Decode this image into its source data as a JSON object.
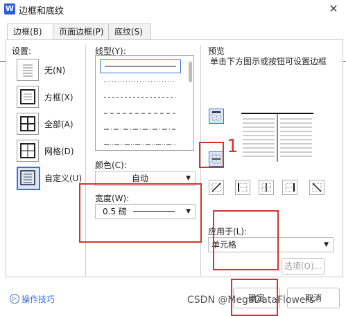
{
  "window": {
    "app_icon_letter": "W",
    "title": "边框和底纹",
    "close_glyph": "✕"
  },
  "tabs": [
    {
      "label": "边框(B)",
      "active": true
    },
    {
      "label": "页面边框(P)",
      "active": false
    },
    {
      "label": "底纹(S)",
      "active": false
    }
  ],
  "settings": {
    "label": "设置:",
    "items": [
      {
        "label": "无(N)",
        "icon": "none-border-icon"
      },
      {
        "label": "方框(X)",
        "icon": "box-border-icon"
      },
      {
        "label": "全部(A)",
        "icon": "all-border-icon"
      },
      {
        "label": "网格(D)",
        "icon": "grid-border-icon"
      },
      {
        "label": "自定义(U)",
        "icon": "custom-border-icon",
        "selected": true
      }
    ]
  },
  "line_style": {
    "label": "线型(Y):",
    "options": [
      "solid",
      "dotted",
      "dashed-fine",
      "dashed",
      "dash-dot",
      "dash-dot-dot"
    ]
  },
  "color": {
    "label": "颜色(C):",
    "value": "自动"
  },
  "width": {
    "label": "宽度(W):",
    "value": "0.5 磅"
  },
  "preview": {
    "label": "预览",
    "hint": "单击下方图示或按钮可设置边框",
    "left_buttons": [
      "top-border-icon",
      "inside-horizontal-border-icon"
    ],
    "bottom_buttons": [
      "diagonal-up-icon",
      "left-border-icon",
      "inside-vertical-border-icon",
      "right-border-icon",
      "diagonal-down-icon"
    ]
  },
  "apply_to": {
    "label": "应用于(L):",
    "value": "单元格"
  },
  "options_button": "选项(O)...",
  "ok_button": "确定",
  "cancel_button": "取消",
  "tips_link": "操作技巧",
  "tips_icon_glyph": "▷",
  "annotation_number": "1",
  "watermark": "CSDN @MegaDataFlowers",
  "colors": {
    "accent": "#3b6fd6",
    "annotation": "#d9302a",
    "selected_bg": "#d8e6f8"
  }
}
